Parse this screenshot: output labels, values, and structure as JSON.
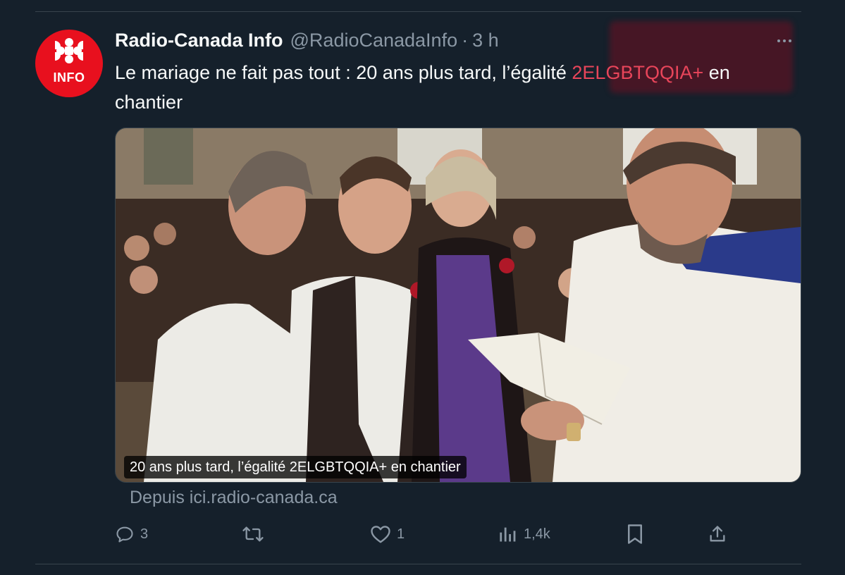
{
  "tweet": {
    "display_name": "Radio-Canada Info",
    "handle": "@RadioCanadaInfo",
    "separator": "·",
    "time": "3 h",
    "avatar": {
      "label": "INFO",
      "brand_color": "#e8101e"
    },
    "text_before": "Le mariage ne fait pas tout : 20 ans plus tard, l’égalité ",
    "hashtag": "2ELGBTQQIA+",
    "text_after": " en chantier",
    "hashtag_color": "#e8455a"
  },
  "media": {
    "caption": "20 ans plus tard, l’égalité 2ELGBTQQIA+ en chantier",
    "source": "Depuis ici.radio-canada.ca"
  },
  "actions": {
    "reply": {
      "icon": "reply-icon",
      "count": "3"
    },
    "repost": {
      "icon": "repost-icon",
      "count": ""
    },
    "like": {
      "icon": "heart-icon",
      "count": "1"
    },
    "views": {
      "icon": "views-icon",
      "count": "1,4k"
    },
    "bookmark": {
      "icon": "bookmark-icon"
    },
    "share": {
      "icon": "share-icon"
    }
  },
  "theme": {
    "background": "#15202b",
    "divider": "#38444d",
    "muted_text": "#8b98a5",
    "primary_text": "#f7f9f9"
  }
}
